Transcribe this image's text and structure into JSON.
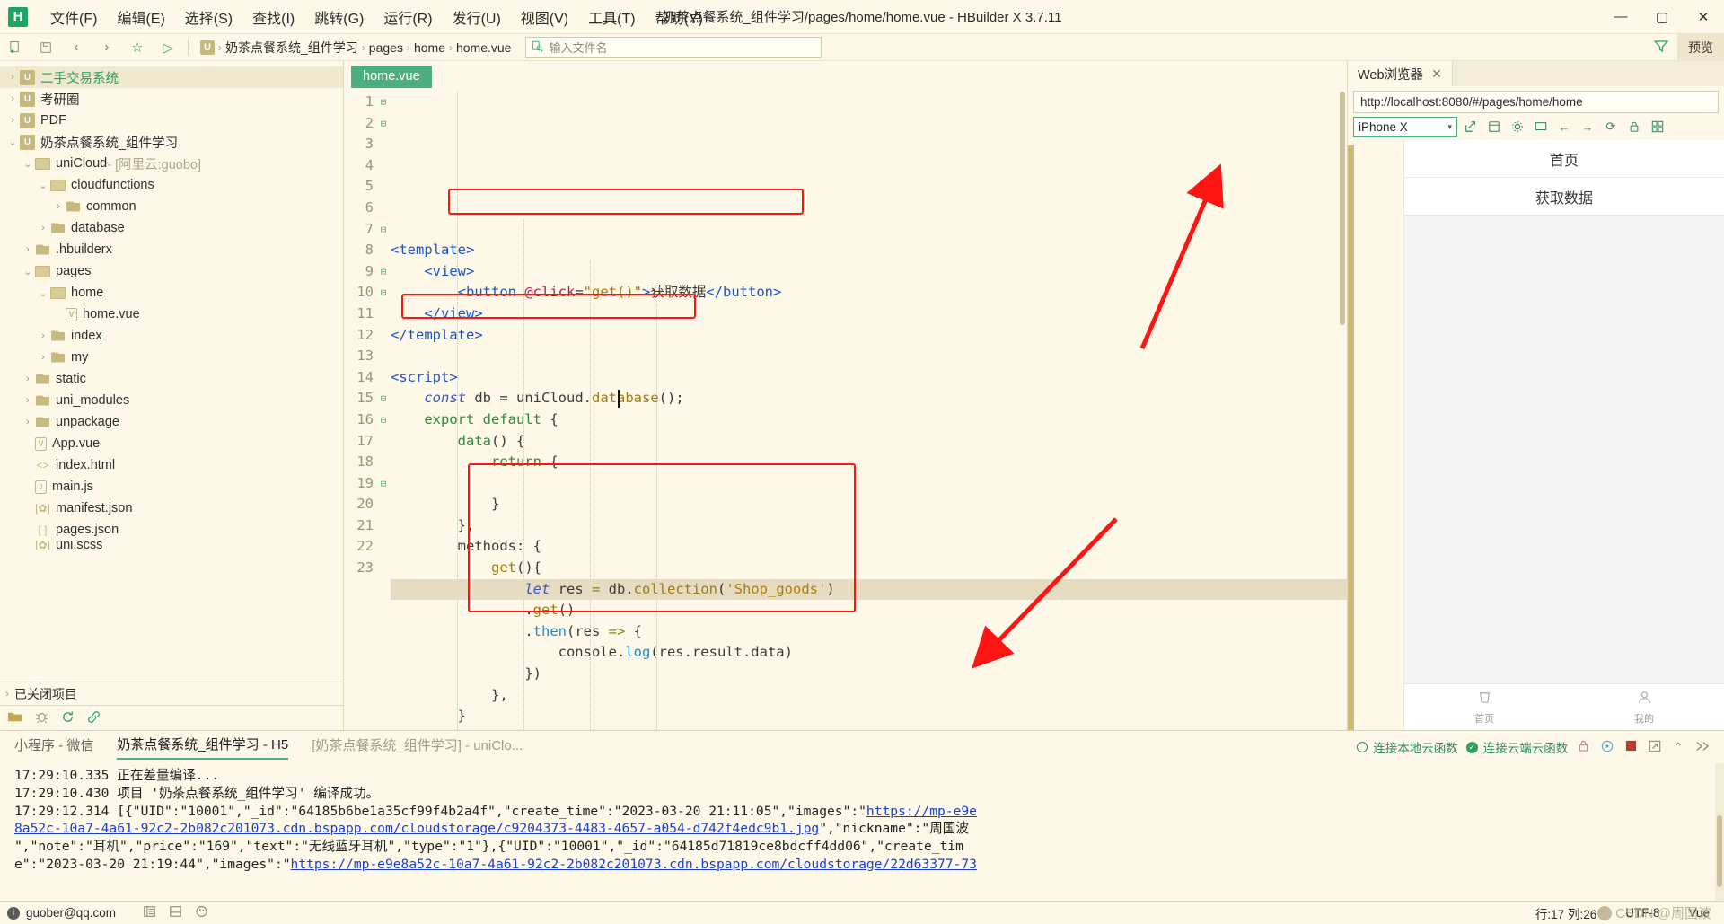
{
  "window": {
    "title": "奶茶点餐系统_组件学习/pages/home/home.vue - HBuilder X 3.7.11",
    "logo": "H",
    "minimize": "—",
    "maximize": "▢",
    "close": "✕"
  },
  "menubar": {
    "items": [
      {
        "label": "文件(F)",
        "name": "menu-file"
      },
      {
        "label": "编辑(E)",
        "name": "menu-edit"
      },
      {
        "label": "选择(S)",
        "name": "menu-select"
      },
      {
        "label": "查找(I)",
        "name": "menu-find"
      },
      {
        "label": "跳转(G)",
        "name": "menu-goto"
      },
      {
        "label": "运行(R)",
        "name": "menu-run"
      },
      {
        "label": "发行(U)",
        "name": "menu-publish"
      },
      {
        "label": "视图(V)",
        "name": "menu-view"
      },
      {
        "label": "工具(T)",
        "name": "menu-tools"
      },
      {
        "label": "帮助(Y)",
        "name": "menu-help"
      }
    ]
  },
  "toolbar": {
    "icons": [
      "新建",
      "保存",
      "后退",
      "前进",
      "收藏",
      "运行"
    ],
    "breadcrumb": {
      "project_icon": "U",
      "items": [
        "奶茶点餐系统_组件学习",
        "pages",
        "home",
        "home.vue"
      ],
      "separator": "›"
    },
    "filename_placeholder": "输入文件名",
    "filter_icon": "filter-icon",
    "preview_label": "预览"
  },
  "sidebar": {
    "tree": [
      {
        "indent": 0,
        "arrow": "›",
        "icon": "uni",
        "label": "二手交易系统",
        "green": true,
        "selected": true
      },
      {
        "indent": 0,
        "arrow": "›",
        "icon": "uni",
        "label": "考研圈"
      },
      {
        "indent": 0,
        "arrow": "›",
        "icon": "uni",
        "label": "PDF"
      },
      {
        "indent": 0,
        "arrow": "⌄",
        "icon": "uni",
        "label": "奶茶点餐系统_组件学习"
      },
      {
        "indent": 1,
        "arrow": "⌄",
        "icon": "folder-open",
        "label": "uniCloud",
        "suffix": " - [阿里云:guobo]"
      },
      {
        "indent": 2,
        "arrow": "⌄",
        "icon": "folder-open",
        "label": "cloudfunctions"
      },
      {
        "indent": 3,
        "arrow": "›",
        "icon": "folder",
        "label": "common"
      },
      {
        "indent": 2,
        "arrow": "›",
        "icon": "folder",
        "label": "database"
      },
      {
        "indent": 1,
        "arrow": "›",
        "icon": "folder",
        "label": ".hbuilderx"
      },
      {
        "indent": 1,
        "arrow": "⌄",
        "icon": "folder-open",
        "label": "pages"
      },
      {
        "indent": 2,
        "arrow": "⌄",
        "icon": "folder-open",
        "label": "home"
      },
      {
        "indent": 3,
        "arrow": "",
        "icon": "vue",
        "label": "home.vue"
      },
      {
        "indent": 2,
        "arrow": "›",
        "icon": "folder",
        "label": "index"
      },
      {
        "indent": 2,
        "arrow": "›",
        "icon": "folder",
        "label": "my"
      },
      {
        "indent": 1,
        "arrow": "›",
        "icon": "folder",
        "label": "static"
      },
      {
        "indent": 1,
        "arrow": "›",
        "icon": "folder",
        "label": "uni_modules"
      },
      {
        "indent": 1,
        "arrow": "›",
        "icon": "folder",
        "label": "unpackage"
      },
      {
        "indent": 1,
        "arrow": "",
        "icon": "vue",
        "label": "App.vue"
      },
      {
        "indent": 1,
        "arrow": "",
        "icon": "code",
        "label": "index.html"
      },
      {
        "indent": 1,
        "arrow": "",
        "icon": "js",
        "label": "main.js"
      },
      {
        "indent": 1,
        "arrow": "",
        "icon": "json",
        "label": "manifest.json"
      },
      {
        "indent": 1,
        "arrow": "",
        "icon": "json2",
        "label": "pages.json"
      },
      {
        "indent": 1,
        "arrow": "",
        "icon": "json",
        "label": "uni.scss",
        "clipped": true
      }
    ],
    "closed_projects": {
      "arrow": "›",
      "label": "已关闭项目"
    },
    "bottom_icons": [
      "folder-icon",
      "bug-icon",
      "refresh-icon",
      "link-icon"
    ]
  },
  "editor": {
    "tab_label": "home.vue",
    "lines": [
      {
        "n": 1,
        "fold": "⊟",
        "html": "<span class='tag'>&lt;template&gt;</span>"
      },
      {
        "n": 2,
        "fold": "⊟",
        "html": "    <span class='tag'>&lt;view&gt;</span>"
      },
      {
        "n": 3,
        "fold": "",
        "html": "        <span class='tag'>&lt;button</span> <span class='attr'>@click</span><span class='plain'>=</span><span class='str'>\"get()\"</span><span class='tag'>&gt;</span><span class='txt'>获取数据</span><span class='tag'>&lt;/button&gt;</span>"
      },
      {
        "n": 4,
        "fold": "",
        "html": "    <span class='tag'>&lt;/view&gt;</span>"
      },
      {
        "n": 5,
        "fold": "",
        "html": "<span class='tag'>&lt;/template&gt;</span>"
      },
      {
        "n": 6,
        "fold": "",
        "html": ""
      },
      {
        "n": 7,
        "fold": "⊟",
        "html": "<span class='tag'>&lt;script&gt;</span>"
      },
      {
        "n": 8,
        "fold": "",
        "html": "    <span class='kw'>const</span> <span class='plain'>db = uniCloud.</span><span class='fn'>database</span><span class='plain'>();</span>"
      },
      {
        "n": 9,
        "fold": "⊟",
        "html": "    <span class='grn'>export default</span> <span class='plain'>{</span>"
      },
      {
        "n": 10,
        "fold": "⊟",
        "html": "        <span class='grn'>data</span><span class='plain'>() {</span>"
      },
      {
        "n": 11,
        "fold": "",
        "html": "            <span class='grn'>return</span> <span class='plain'>{</span>"
      },
      {
        "n": 12,
        "fold": "",
        "html": ""
      },
      {
        "n": 13,
        "fold": "",
        "html": "            <span class='plain'>}</span>"
      },
      {
        "n": 14,
        "fold": "",
        "html": "        <span class='plain'>},</span>"
      },
      {
        "n": 15,
        "fold": "⊟",
        "html": "        <span class='plain'>methods: {</span>"
      },
      {
        "n": 16,
        "fold": "⊟",
        "html": "            <span class='fn'>get</span><span class='plain'>(){</span>"
      },
      {
        "n": 17,
        "fold": "",
        "html": "                <span class='kw'>let</span> <span class='plain'>res </span><span class='op'>=</span><span class='plain'> db.</span><span class='fn'>collection</span><span class='plain'>(</span><span class='str'>'Shop_goods'</span><span class='plain'>)</span>",
        "highlight": true
      },
      {
        "n": 18,
        "fold": "",
        "html": "                <span class='plain'>.</span><span class='fn'>get</span><span class='plain'>()</span>"
      },
      {
        "n": 19,
        "fold": "⊟",
        "html": "                <span class='plain'>.</span><span class='blu'>then</span><span class='plain'>(res </span><span class='op'>=&gt;</span><span class='plain'> {</span>"
      },
      {
        "n": 20,
        "fold": "",
        "html": "                    <span class='plain'>console.</span><span class='blu'>log</span><span class='plain'>(res.result.data)</span>"
      },
      {
        "n": 21,
        "fold": "",
        "html": "                <span class='plain'>})</span>"
      },
      {
        "n": 22,
        "fold": "",
        "html": "            <span class='plain'>},</span>"
      },
      {
        "n": 23,
        "fold": "",
        "html": "        <span class='plain'>}</span>"
      }
    ]
  },
  "preview": {
    "tab_label": "Web浏览器",
    "tab_close": "✕",
    "url": "http://localhost:8080/#/pages/home/home",
    "device": "iPhone X",
    "device_caret": "▾",
    "toolbar_icons": [
      "popout-icon",
      "layers-icon",
      "gear-icon",
      "screen-icon",
      "back-icon",
      "forward-icon",
      "reload-icon",
      "lock-icon",
      "grid-icon"
    ],
    "page": {
      "nav_title": "首页",
      "button_label": "获取数据",
      "tabbar": [
        {
          "icon": "cup-icon",
          "label": "首页"
        },
        {
          "icon": "person-icon",
          "label": "我的"
        }
      ]
    }
  },
  "console": {
    "tabs": [
      {
        "label": "小程序 - 微信",
        "active": false,
        "faded": false
      },
      {
        "label": "奶茶点餐系统_组件学习 - H5",
        "active": true,
        "faded": false
      },
      {
        "label": "[奶茶点餐系统_组件学习] - uniClo...",
        "active": false,
        "faded": true
      }
    ],
    "status": [
      {
        "icon": "circle-outline",
        "label": "连接本地云函数"
      },
      {
        "icon": "circle-check",
        "label": "连接云端云函数"
      }
    ],
    "action_icons": [
      "lock-icon",
      "play-icon",
      "stop-icon",
      "export-icon",
      "collapse-icon",
      "clear-icon"
    ],
    "log_lines": [
      {
        "time": "17:29:10.335",
        "text": "正在差量编译..."
      },
      {
        "time": "17:29:10.430",
        "text": "项目 '奶茶点餐系统_组件学习' 编译成功。"
      },
      {
        "time": "17:29:12.314",
        "text": "[{\"UID\":\"10001\",\"_id\":\"64185b6be1a35cf99f4b2a4f\",\"create_time\":\"2023-03-20 21:11:05\",\"images\":\"",
        "link_tail": "https://mp-e9e"
      },
      {
        "time": "",
        "link": "8a52c-10a7-4a61-92c2-2b082c201073.cdn.bspapp.com/cloudstorage/c9204373-4483-4657-a054-d742f4edc9b1.jpg",
        "text": "\",\"nickname\":\"周国波"
      },
      {
        "time": "",
        "text": "\",\"note\":\"耳机\",\"price\":\"169\",\"text\":\"无线蓝牙耳机\",\"type\":\"1\"},{\"UID\":\"10001\",\"_id\":\"64185d71819ce8bdcff4dd06\",\"create_tim"
      },
      {
        "time": "",
        "text": "e\":\"2023-03-20 21:19:44\",\"images\":\"",
        "link_tail": "https://mp-e9e8a52c-10a7-4a61-92c2-2b082c201073.cdn.bspapp.com/cloudstorage/22d63377-73"
      }
    ]
  },
  "statusbar": {
    "account": "guober@qq.com",
    "icons": [
      "list-icon",
      "layout-icon",
      "palette-icon"
    ],
    "line_col": "行:17 列:26",
    "encoding": "UTF-8",
    "language": "Vue"
  },
  "watermark": "CSDN @周国波",
  "colors": {
    "accent_green": "#4caf7d",
    "annotation_red": "#ff1414",
    "background": "#fdf8e7",
    "folder_gold": "#c6b87e"
  }
}
